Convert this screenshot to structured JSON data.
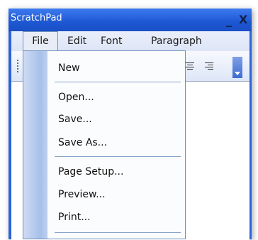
{
  "window": {
    "title": "ScratchPad",
    "minimize_glyph": "_",
    "close_glyph": "X"
  },
  "menubar": {
    "items": [
      {
        "label": "File"
      },
      {
        "label": "Edit"
      },
      {
        "label": "Font"
      },
      {
        "label": "Paragraph"
      }
    ]
  },
  "toolbar": {
    "icons": [
      "align-center-icon",
      "align-right-icon"
    ]
  },
  "file_menu": {
    "items": [
      {
        "label": "New"
      },
      {
        "label": "Open..."
      },
      {
        "label": "Save..."
      },
      {
        "label": "Save As..."
      },
      {
        "label": "Page Setup..."
      },
      {
        "label": "Preview..."
      },
      {
        "label": "Print..."
      }
    ]
  },
  "colors": {
    "title_bar": "#1d57d2",
    "menu_border": "#6f8fbd",
    "menu_strip": "#a7c0ea"
  }
}
